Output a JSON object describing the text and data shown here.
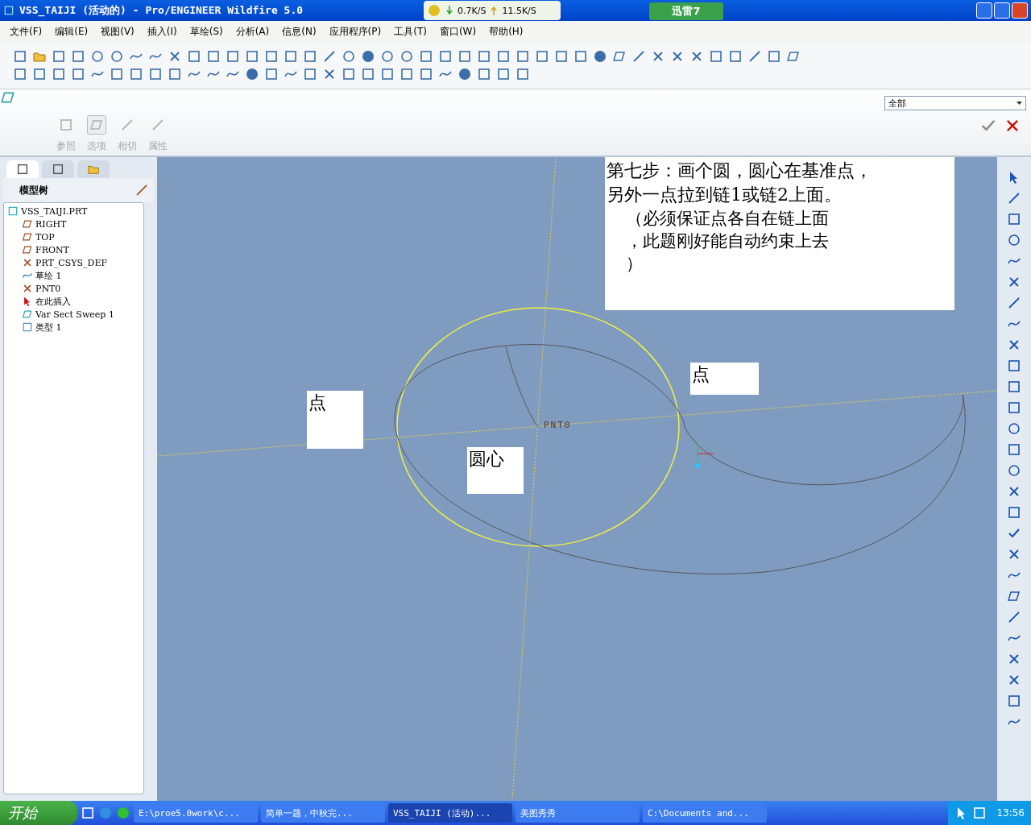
{
  "window": {
    "title": "VSS_TAIJI (活动的) - Pro/ENGINEER Wildfire 5.0"
  },
  "speed_widget": {
    "down": "0.7K/S",
    "up": "11.5K/S"
  },
  "logo": {
    "text": "迅雷7"
  },
  "menu": [
    "文件(F)",
    "编辑(E)",
    "视图(V)",
    "插入(I)",
    "草绘(S)",
    "分析(A)",
    "信息(N)",
    "应用程序(P)",
    "工具(T)",
    "窗口(W)",
    "帮助(H)"
  ],
  "dashboard": {
    "tabs": [
      {
        "label": "参照",
        "selected": false
      },
      {
        "label": "选项",
        "selected": true
      },
      {
        "label": "相切",
        "selected": false
      },
      {
        "label": "属性",
        "selected": false
      }
    ],
    "filter": "全部"
  },
  "sidebar": {
    "tabs": [
      {
        "selected": true
      },
      {
        "selected": false
      },
      {
        "selected": false
      }
    ],
    "title": "模型树",
    "tree": {
      "label": "VSS_TAIJI.PRT",
      "kind": "part",
      "children": [
        {
          "label": "RIGHT",
          "kind": "plane"
        },
        {
          "label": "TOP",
          "kind": "plane"
        },
        {
          "label": "FRONT",
          "kind": "plane"
        },
        {
          "label": "PRT_CSYS_DEF",
          "kind": "csys"
        },
        {
          "label": "草绘 1",
          "kind": "sketch"
        },
        {
          "label": "PNT0",
          "kind": "point"
        },
        {
          "label": "在此插入",
          "kind": "insert"
        },
        {
          "label": "Var Sect Sweep 1",
          "kind": "sweep"
        },
        {
          "label": "类型 1",
          "kind": "type"
        }
      ]
    }
  },
  "canvas": {
    "point_label": "PNT0",
    "notes": [
      {
        "kind": "big",
        "lines": [
          "第七步：画个圆，圆心在基准点，",
          "另外一点拉到链1或链2上面。",
          "（必须保证点各自在链上面",
          "，此题刚好能自动约束上去",
          "）"
        ]
      },
      {
        "kind": "small",
        "lines": [
          "点"
        ]
      },
      {
        "kind": "small",
        "lines": [
          "点"
        ]
      },
      {
        "kind": "small",
        "lines": [
          "圆心"
        ]
      }
    ]
  },
  "taskbar": {
    "start": "开始",
    "items": [
      {
        "label": "E:\\proe5.0work\\c...",
        "selected": false
      },
      {
        "label": "简单一题，中秋完...",
        "selected": false
      },
      {
        "label": "VSS_TAIJI (活动)...",
        "selected": true
      },
      {
        "label": "美图秀秀",
        "selected": false
      },
      {
        "label": "C:\\Documents and...",
        "selected": false
      }
    ],
    "clock": "13:56"
  }
}
